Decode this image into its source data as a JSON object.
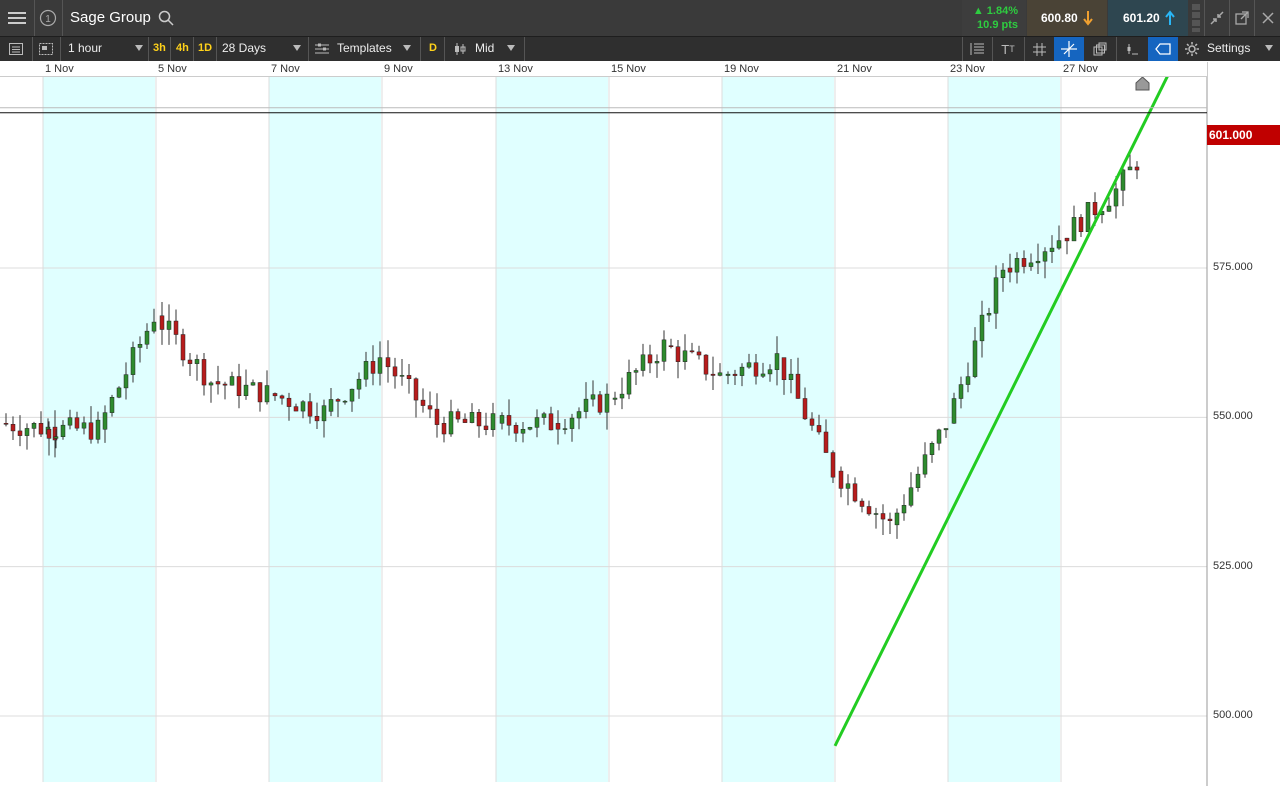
{
  "header": {
    "menu_icon": "hamburger-icon",
    "info_icon": "info-icon",
    "title": "Sage Group",
    "search_icon": "search-icon",
    "change_pct": "▲ 1.84%",
    "change_pts": "10.9 pts",
    "sell_price": "600.80",
    "buy_price": "601.20",
    "sell_arrow_icon": "arrow-down-icon",
    "buy_arrow_icon": "arrow-up-icon",
    "collapse_icon": "collapse-icon",
    "popout_icon": "popout-icon",
    "close_icon": "close-icon",
    "colors": {
      "up": "#2ecc40",
      "sell_bg": "#4a4336",
      "buy_bg": "#2e4650",
      "buy_arrow": "#29b6f6",
      "sell_arrow": "#f0a030"
    }
  },
  "toolbar": {
    "interval": "1 hour",
    "quick_3h": "3h",
    "quick_4h": "4h",
    "quick_1d": "1D",
    "range": "28 Days",
    "templates": "Templates",
    "d_toggle": "D",
    "price_type": "Mid",
    "settings": "Settings"
  },
  "chart_data": {
    "type": "candlestick",
    "instrument": "Sage Group",
    "interval": "1 hour",
    "x_tick_labels": [
      "1 Nov",
      "5 Nov",
      "7 Nov",
      "9 Nov",
      "13 Nov",
      "15 Nov",
      "19 Nov",
      "21 Nov",
      "23 Nov",
      "27 Nov"
    ],
    "y_tick_labels": [
      "575.000",
      "550.000",
      "525.000",
      "500.000"
    ],
    "ylim": [
      490,
      611
    ],
    "current_price_label": "601.000",
    "current_price": 601,
    "daily_closes": [
      {
        "session": "31 Oct",
        "close": 548
      },
      {
        "session": "1 Nov",
        "close": 548
      },
      {
        "session": "2 Nov",
        "close": 567
      },
      {
        "session": "5 Nov",
        "close": 556
      },
      {
        "session": "6 Nov",
        "close": 554
      },
      {
        "session": "7 Nov",
        "close": 551
      },
      {
        "session": "8 Nov",
        "close": 560
      },
      {
        "session": "9 Nov",
        "close": 549
      },
      {
        "session": "12 Nov",
        "close": 549
      },
      {
        "session": "13 Nov",
        "close": 549
      },
      {
        "session": "14 Nov",
        "close": 553
      },
      {
        "session": "15 Nov",
        "close": 562
      },
      {
        "session": "16 Nov",
        "close": 557
      },
      {
        "session": "19 Nov",
        "close": 560
      },
      {
        "session": "20 Nov",
        "close": 541
      },
      {
        "session": "21 Nov",
        "close": 532
      },
      {
        "session": "22 Nov",
        "close": 549
      },
      {
        "session": "23 Nov",
        "close": 575
      },
      {
        "session": "26 Nov",
        "close": 580
      },
      {
        "session": "27 Nov",
        "close": 588
      },
      {
        "session": "28 Nov",
        "close": 601
      }
    ],
    "trendline": {
      "start": {
        "session": "21 Nov",
        "price": 495
      },
      "end": {
        "session": "28 Nov",
        "price": 611
      },
      "color": "#22cc22"
    },
    "colors": {
      "up": "#2e8b2e",
      "down": "#b71c1c",
      "weekend_shade": "#e0ffff"
    }
  }
}
